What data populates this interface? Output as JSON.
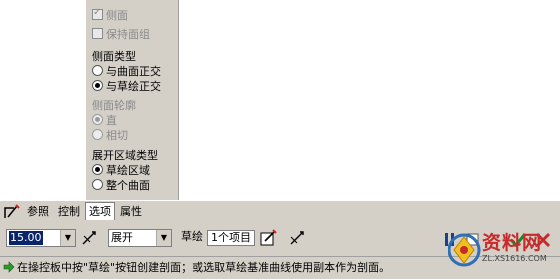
{
  "options_panel": {
    "side_checkbox": {
      "label": "侧面",
      "checked": true,
      "enabled": false
    },
    "keep_surface_group": {
      "label": "保持面组",
      "checked": false,
      "enabled": false
    },
    "side_type": {
      "title": "侧面类型",
      "options": [
        {
          "label": "与曲面正交",
          "selected": false
        },
        {
          "label": "与草绘正交",
          "selected": true
        }
      ]
    },
    "side_profile": {
      "title": "侧面轮廓",
      "enabled": false,
      "options": [
        {
          "label": "直",
          "selected": true
        },
        {
          "label": "相切",
          "selected": false
        }
      ]
    },
    "unfold_region_type": {
      "title": "展开区域类型",
      "options": [
        {
          "label": "草绘区域",
          "selected": true
        },
        {
          "label": "整个曲面",
          "selected": false
        }
      ]
    }
  },
  "tabs": [
    {
      "label": "参照",
      "active": false
    },
    {
      "label": "控制",
      "active": false
    },
    {
      "label": "选项",
      "active": true
    },
    {
      "label": "属性",
      "active": false
    }
  ],
  "toolbar": {
    "offset_value": "15.00",
    "mode_value": "展开",
    "sketch_label": "草绘",
    "sketch_items": "1个项目"
  },
  "status": {
    "message": "在操控板中按\"草绘\"按钮创建剖面；或选取草绘基准曲线使用副本作为剖面。"
  },
  "watermark": {
    "title": "资料网",
    "url": "ZL.XS1616.COM"
  },
  "colors": {
    "panel_bg": "#d4d0c8",
    "selection_bg": "#0a246a",
    "watermark_red": "#c62a2a"
  }
}
